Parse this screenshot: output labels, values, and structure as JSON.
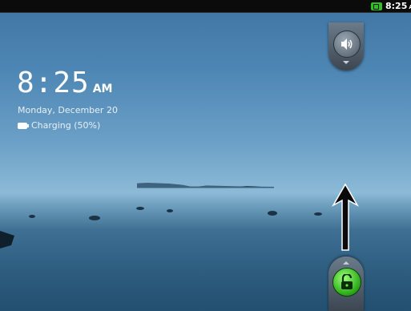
{
  "status_bar": {
    "time": "8:25",
    "ampm": "AM",
    "battery_icon": "battery-charging-icon"
  },
  "lock_screen": {
    "clock": {
      "time": "8:25",
      "ampm": "AM"
    },
    "date": "Monday, December 20",
    "charging": "Charging (50%)"
  },
  "controls": {
    "sound_toggle_icon": "speaker-icon",
    "unlock_icon": "unlock-padlock-icon"
  },
  "colors": {
    "accent_green": "#2fbf24",
    "status_bar": "#0b0b0b"
  }
}
